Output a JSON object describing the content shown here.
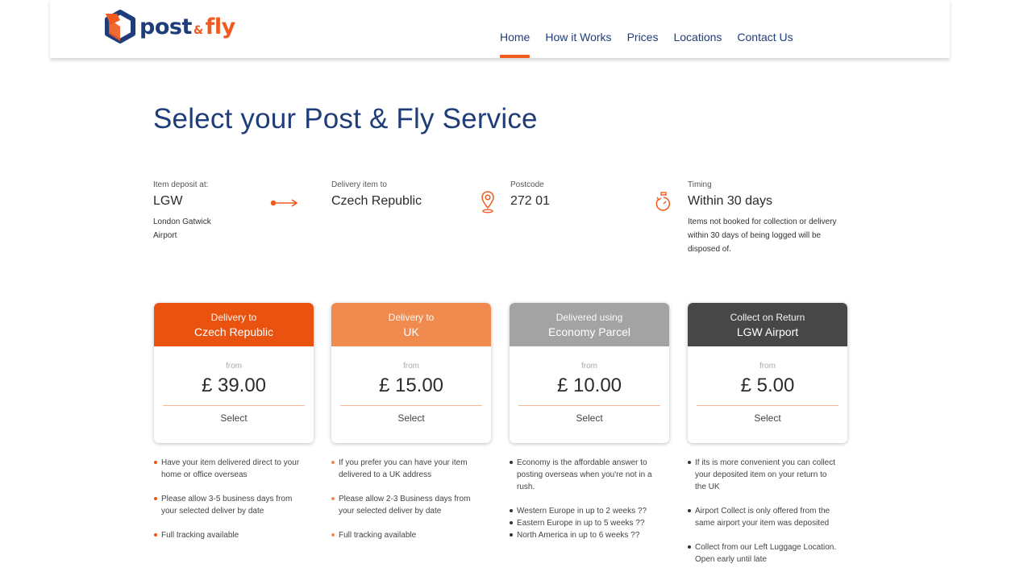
{
  "brand": {
    "name_part1": "post",
    "amp": "&",
    "name_part2": "fly",
    "accent": "#f05a1e",
    "navy": "#1f3d7a"
  },
  "nav": {
    "items": [
      "Home",
      "How it Works",
      "Prices",
      "Locations",
      "Contact Us"
    ],
    "active": "Home"
  },
  "page": {
    "title": "Select your Post & Fly Service"
  },
  "summary": {
    "deposit": {
      "label": "Item deposit at:",
      "value": "LGW",
      "sub1": "London Gatwick",
      "sub2": "Airport",
      "icon": "arrow-right-icon"
    },
    "delivery": {
      "label": "Delivery item to",
      "value": "Czech Republic"
    },
    "postcode": {
      "label": "Postcode",
      "value": "272 01",
      "icon": "location-pin-icon"
    },
    "timing": {
      "label": "Timing",
      "value": "Within 30 days",
      "icon": "stopwatch-icon",
      "note1": "Items not booked for collection or delivery",
      "note2": "within 30 days of being logged will be",
      "note3": "disposed of."
    }
  },
  "cards": [
    {
      "line1": "Delivery to",
      "line2": "Czech Republic",
      "from": "from",
      "price": "£ 39.00",
      "select": "Select",
      "color": "#e9530f"
    },
    {
      "line1": "Delivery to",
      "line2": "UK",
      "from": "from",
      "price": "£ 15.00",
      "select": "Select",
      "color": "#f08a4f"
    },
    {
      "line1": "Delivered using",
      "line2": "Economy Parcel",
      "from": "from",
      "price": "£ 10.00",
      "select": "Select",
      "color": "#a3a3a3"
    },
    {
      "line1": "Collect on Return",
      "line2": "LGW Airport",
      "from": "from",
      "price": "£ 5.00",
      "select": "Select",
      "color": "#474747"
    }
  ],
  "bullets": {
    "c1": [
      {
        "l1": "Have your item delivered direct to your",
        "l2": "home or office overseas"
      },
      {
        "l1": "Please allow 3-5 business days from",
        "l2": "your selected deliver by date"
      },
      {
        "l1": "Full tracking available"
      }
    ],
    "c2": [
      {
        "l1": "If you prefer you can have your item",
        "l2": "delivered to a UK address"
      },
      {
        "l1": "Please allow 2-3 Business days from",
        "l2": "your selected deliver by date"
      },
      {
        "l1": "Full tracking available"
      }
    ],
    "c3": [
      {
        "l1": "Economy is the affordable answer to",
        "l2": "posting overseas when you're not in a",
        "l3": "rush."
      },
      {
        "l1": "Western Europe in up to 2 weeks ??"
      },
      {
        "l1": "Eastern Europe in up to 5 weeks ??"
      },
      {
        "l1": "North America in up to 6 weeks ??"
      }
    ],
    "c4": [
      {
        "l1": "If its is more convenient you can collect",
        "l2": "your deposited item on your return to",
        "l3": "the UK"
      },
      {
        "l1": "Airport Collect is only offered from the",
        "l2": "same airport your item was deposited"
      },
      {
        "l1": "Collect from our Left Luggage Location.",
        "l2": "Open early until late"
      }
    ]
  }
}
